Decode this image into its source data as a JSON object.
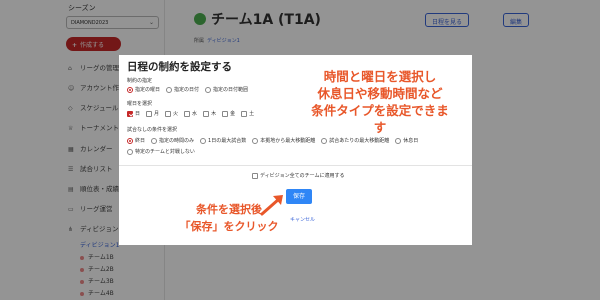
{
  "sidebar": {
    "season_label": "シーズン",
    "season_value": "DIAMOND2023",
    "create_label": "作成する",
    "items": [
      {
        "label": "リーグの管理",
        "icon": "home-icon"
      },
      {
        "label": "アカウント作成",
        "icon": "user-icon"
      },
      {
        "label": "スケジュール",
        "icon": "diamond-icon"
      },
      {
        "label": "トーナメント",
        "icon": "trophy-icon"
      },
      {
        "label": "カレンダー",
        "icon": "calendar-icon"
      },
      {
        "label": "試合リスト",
        "icon": "list-icon"
      },
      {
        "label": "順位表・成績",
        "icon": "chart-icon"
      },
      {
        "label": "リーグ運営",
        "icon": "folder-icon"
      },
      {
        "label": "ディビジョン",
        "icon": "tree-icon"
      }
    ],
    "division_active": "ディビジョン1",
    "teams": [
      "チーム1B",
      "チーム2B",
      "チーム3B",
      "チーム4B"
    ]
  },
  "header": {
    "team_title": "チーム1A (T1A)",
    "belongs_label": "所属",
    "division_link": "ディビジョン1",
    "view_schedule_label": "日程を見る",
    "edit_label": "編集"
  },
  "modal": {
    "title": "日程の制約を設定する",
    "restriction_label": "制約の指定",
    "restriction_options": [
      "指定の曜日",
      "指定の日付",
      "指定の日付範囲"
    ],
    "weekday_label": "曜日を選択",
    "weekdays": [
      "日",
      "月",
      "火",
      "水",
      "木",
      "金",
      "土"
    ],
    "condition_label": "試合なしの条件を選択",
    "conditions_row1": [
      "終日",
      "指定の時間のみ",
      "1日の最大試合数",
      "本拠地から最大移動距離",
      "試合あたりの最大移動距離",
      "休息日"
    ],
    "conditions_row2": [
      "特定のチームと対戦しない"
    ],
    "apply_all_label": "ディビジョン全てのチームに適用する",
    "save_label": "保存",
    "cancel_label": "キャンセル"
  },
  "annotations": {
    "top_lines": [
      "時間と曜日を選択し",
      "休息日や移動時間など",
      "条件タイプを設定できます"
    ],
    "bottom_lines": [
      "条件を選択後",
      "「保存」をクリック"
    ]
  },
  "colors": {
    "accent_red": "#c62828",
    "primary_blue": "#2f86f6",
    "annotation_orange": "#e8572a",
    "team_green": "#4caf50"
  }
}
